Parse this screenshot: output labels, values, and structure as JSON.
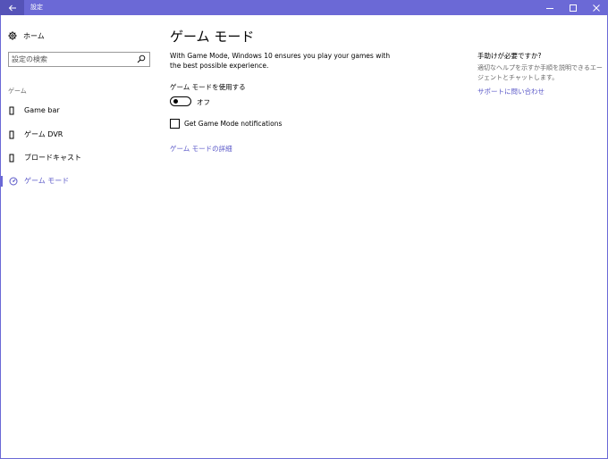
{
  "window": {
    "title": "設定",
    "accent_color": "#6b69d6"
  },
  "sidebar": {
    "home_label": "ホーム",
    "search_placeholder": "設定の検索",
    "section_label": "ゲーム",
    "items": [
      {
        "label": "Game bar",
        "icon": "game-bar-icon"
      },
      {
        "label": "ゲーム DVR",
        "icon": "game-dvr-icon"
      },
      {
        "label": "ブロードキャスト",
        "icon": "broadcast-icon"
      },
      {
        "label": "ゲーム モード",
        "icon": "game-mode-icon",
        "active": true
      }
    ]
  },
  "main": {
    "title": "ゲーム モード",
    "description": "With Game Mode, Windows 10 ensures you play your games with the best possible experience.",
    "toggle_label": "ゲーム モードを使用する",
    "toggle_state": "オフ",
    "checkbox_label": "Get Game Mode notifications",
    "details_link": "ゲーム モードの詳細"
  },
  "help": {
    "title": "手助けが必要ですか?",
    "description": "適切なヘルプを示すか手順を説明できるエージェントとチャットします。",
    "link": "サポートに問い合わせ"
  }
}
